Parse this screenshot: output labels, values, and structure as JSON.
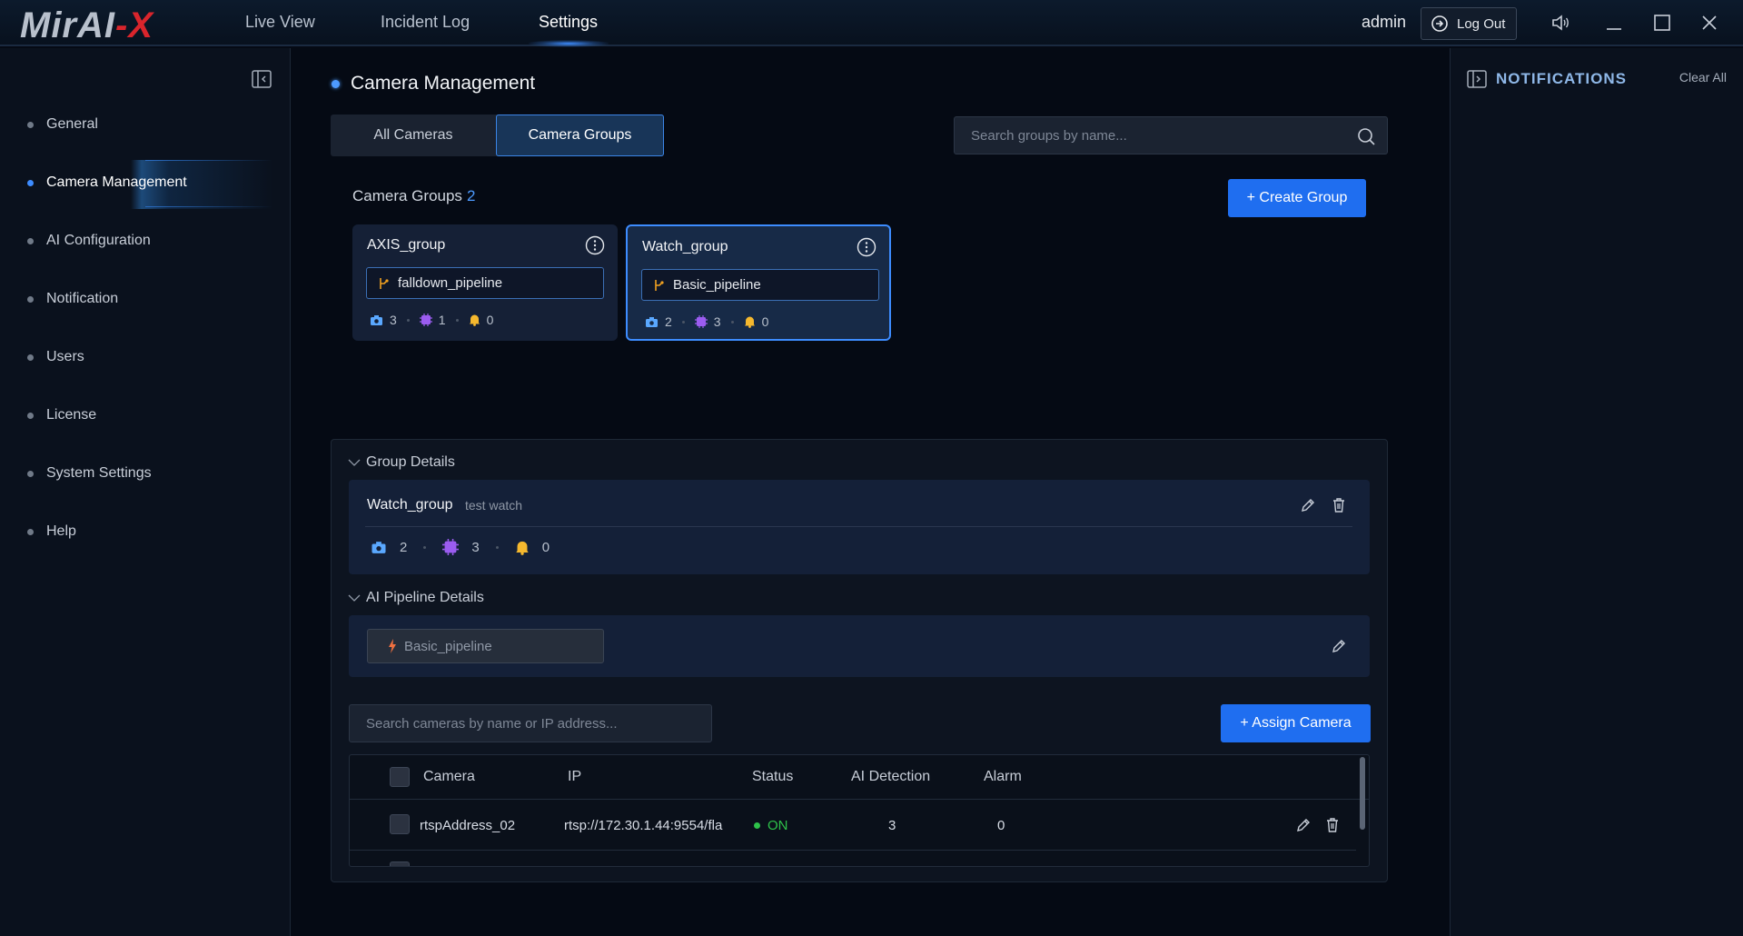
{
  "app": {
    "logo_part1": "MirAI",
    "logo_part2": "-X"
  },
  "nav": {
    "tabs": [
      "Live View",
      "Incident Log",
      "Settings"
    ],
    "active": "Settings"
  },
  "header": {
    "user": "admin",
    "logout_label": "Log Out"
  },
  "sidebar": {
    "items": [
      "General",
      "Camera Management",
      "AI Configuration",
      "Notification",
      "Users",
      "License",
      "System Settings",
      "Help"
    ],
    "active": "Camera Management"
  },
  "page": {
    "title": "Camera Management"
  },
  "tabs": {
    "all_cameras": "All Cameras",
    "camera_groups": "Camera Groups"
  },
  "group_search": {
    "placeholder": "Search groups by name..."
  },
  "groups": {
    "label": "Camera Groups",
    "count": "2",
    "create_label": "+ Create Group",
    "cards": [
      {
        "name": "AXIS_group",
        "pipeline": "falldown_pipeline",
        "cameras": "3",
        "ai": "1",
        "alarms": "0"
      },
      {
        "name": "Watch_group",
        "pipeline": "Basic_pipeline",
        "cameras": "2",
        "ai": "3",
        "alarms": "0"
      }
    ]
  },
  "group_details": {
    "title": "Group Details",
    "name": "Watch_group",
    "description": "test watch",
    "cameras": "2",
    "ai": "3",
    "alarms": "0"
  },
  "pipeline_details": {
    "title": "AI Pipeline Details",
    "pipeline": "Basic_pipeline"
  },
  "camera_search": {
    "placeholder": "Search cameras by name or IP address..."
  },
  "assign_label": "+ Assign Camera",
  "table": {
    "headers": [
      "Camera",
      "IP",
      "Status",
      "AI Detection",
      "Alarm"
    ],
    "rows": [
      {
        "camera": "rtspAddress_02",
        "ip": "rtsp://172.30.1.44:9554/fla",
        "status": "ON",
        "ai_detection": "3",
        "alarm": "0"
      }
    ]
  },
  "notifications": {
    "title": "NOTIFICATIONS",
    "clear_label": "Clear All"
  },
  "colors": {
    "accent": "#1f6ef0",
    "status_on": "#2ec24a",
    "brand_red": "#d9252c"
  }
}
